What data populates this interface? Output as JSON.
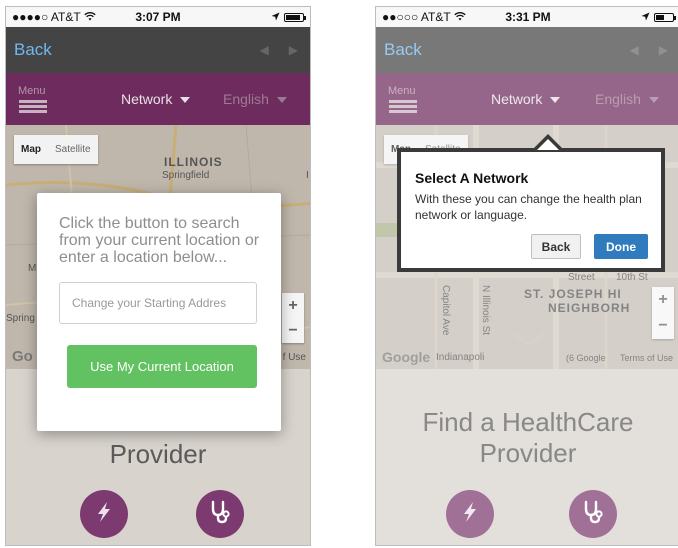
{
  "left_screen": {
    "status_bar": {
      "carrier": "●●●●○ AT&T",
      "time": "3:07 PM",
      "battery_level": 0.9
    },
    "nav_bar": {
      "back_label": "Back"
    },
    "menu_bar": {
      "menu_label": "Menu",
      "network_label": "Network",
      "language_label": "English"
    },
    "map": {
      "map_tab": "Map",
      "satellite_tab": "Satellite",
      "state_label": "ILLINOIS",
      "city_label": "Springfield",
      "edge_label_m": "M",
      "edge_label_i": "I",
      "edge_label_spring": "Spring",
      "zoom_in": "+",
      "zoom_out": "−",
      "google": "Go",
      "terms": "f Use"
    },
    "search_dialog": {
      "prompt": "Click the button to search from your current location or enter a location below...",
      "address_placeholder": "Change your Starting Addres",
      "current_location_button": "Use My Current Location"
    },
    "provider_label": "Provider"
  },
  "right_screen": {
    "status_bar": {
      "carrier": "●●○○○ AT&T",
      "time": "3:31 PM",
      "battery_level": 0.5
    },
    "nav_bar": {
      "back_label": "Back"
    },
    "menu_bar": {
      "menu_label": "Menu",
      "network_label": "Network",
      "language_label": "English"
    },
    "map": {
      "map_tab": "Map",
      "satellite_tab": "Satellite",
      "neighborhood_line1": "ST. JOSEPH HI",
      "neighborhood_line2": "NEIGHBORH",
      "street_label": "Street",
      "street_label_right": "10th St",
      "street_illinois": "N Illinois St",
      "street_capitol": "Capitol Ave",
      "zoom_in": "+",
      "zoom_out": "−",
      "google": "Google",
      "city_fragment": "Indianapoli",
      "copyright": "(6 Google",
      "terms": "Terms of Use"
    },
    "network_popover": {
      "title": "Select A Network",
      "body": "With these you can change the health plan network or language.",
      "back_button": "Back",
      "done_button": "Done"
    },
    "find_title_line1": "Find a HealthCare",
    "find_title_line2": "Provider"
  },
  "icons": {
    "signal": "wifi-icon",
    "location": "location-arrow-icon",
    "quick": "lightning-icon",
    "doctor": "stethoscope-icon"
  },
  "colors": {
    "menu_bar": "#6e2c5e",
    "nav_bar": "#444444",
    "back_link": "#6fb8f0",
    "primary_green": "#62c262",
    "done_blue": "#2f7bbd",
    "circle_button": "#7d3a70"
  }
}
